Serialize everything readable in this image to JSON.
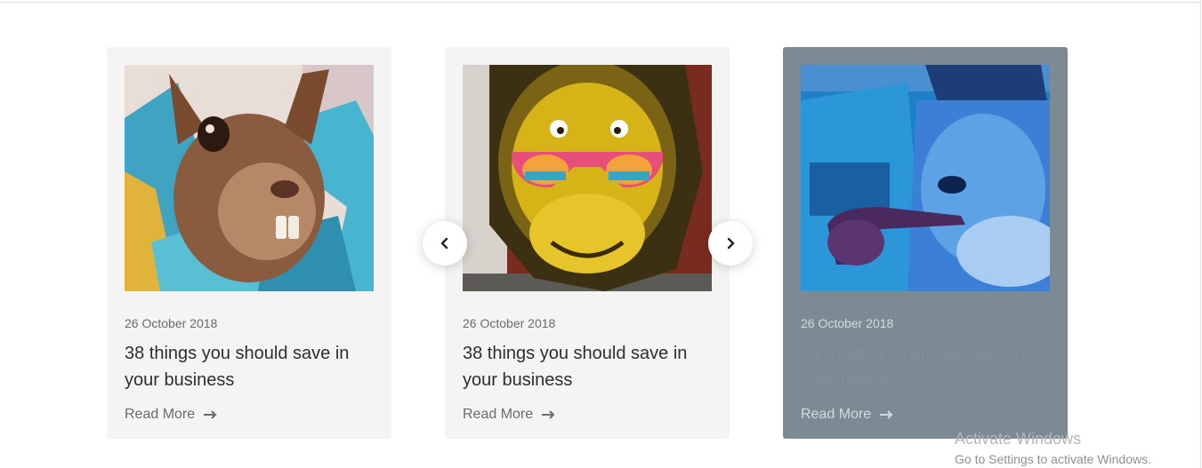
{
  "cards": [
    {
      "date": "26 October 2018",
      "title": "38 things you should save in your business",
      "read_more": "Read More",
      "image_icon": "graffiti-squirrel-image"
    },
    {
      "date": "26 October 2018",
      "title": "38 things you should save in your business",
      "read_more": "Read More",
      "image_icon": "graffiti-monkey-sunglasses-image"
    },
    {
      "date": "26 October 2018",
      "title": "38 things you should save in your business",
      "read_more": "Read More",
      "image_icon": "graffiti-blue-man-pipe-image"
    }
  ],
  "carousel": {
    "prev_icon": "chevron-left-icon",
    "next_icon": "chevron-right-icon"
  },
  "watermark": {
    "line1": "Activate Windows",
    "line2": "Go to Settings to activate Windows."
  },
  "colors": {
    "card_bg": "#f4f4f4",
    "card_active_overlay": "#7b8a93",
    "text_dark": "#2e2e2e",
    "text_muted": "#6b6b6b"
  }
}
